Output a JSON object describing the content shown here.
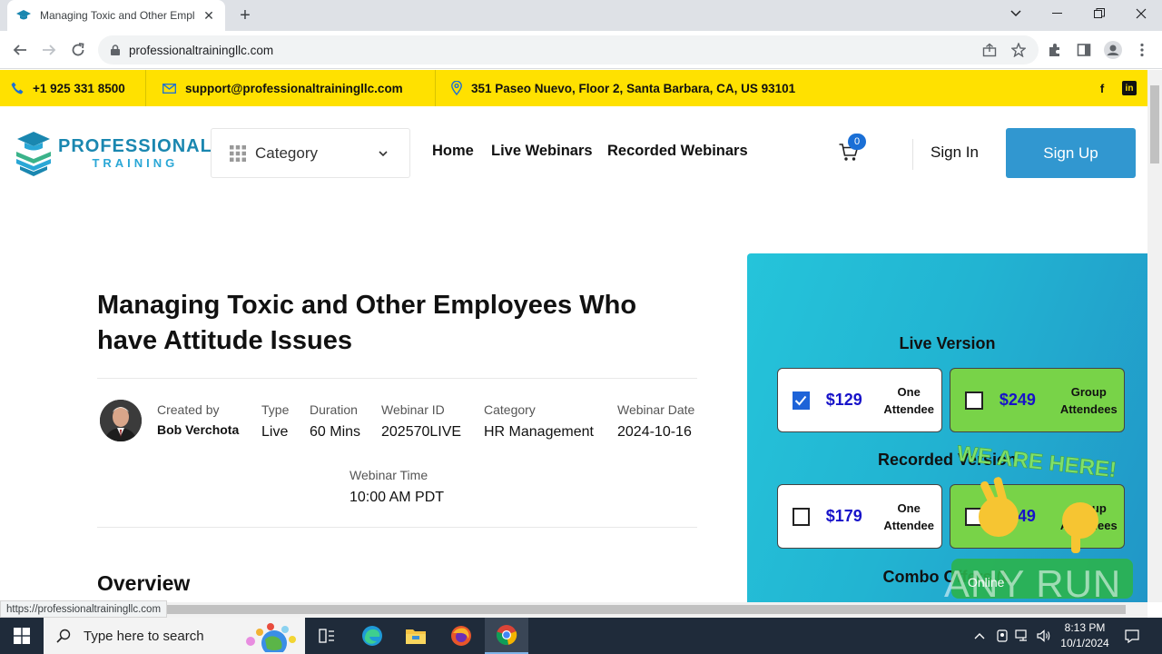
{
  "browser": {
    "tab_title": "Managing Toxic and Other Empl",
    "url": "professionaltrainingllc.com",
    "status_url": "https://professionaltrainingllc.com"
  },
  "topbar": {
    "phone": "+1 925 331 8500",
    "email": "support@professionaltrainingllc.com",
    "address": "351 Paseo Nuevo, Floor 2, Santa Barbara, CA, US 93101",
    "social_facebook": "f",
    "social_linkedin": "in"
  },
  "header": {
    "logo_line1": "PROFESSIONAL",
    "logo_line2": "TRAINING",
    "category_label": "Category",
    "nav": [
      "Home",
      "Live Webinars",
      "Recorded Webinars"
    ],
    "cart_count": "0",
    "sign_in": "Sign In",
    "sign_up": "Sign Up"
  },
  "webinar": {
    "title": "Managing Toxic and Other Employees Who have Attitude Issues",
    "created_by_label": "Created by",
    "created_by": "Bob Verchota",
    "type_label": "Type",
    "type": "Live",
    "duration_label": "Duration",
    "duration": "60 Mins",
    "id_label": "Webinar ID",
    "id": "202570LIVE",
    "category_label": "Category",
    "category": "HR Management",
    "date_label": "Webinar Date",
    "date": "2024-10-16",
    "time_label": "Webinar Time",
    "time": "10:00 AM PDT",
    "overview": "Overview"
  },
  "pricing": {
    "live_heading": "Live Version",
    "recorded_heading": "Recorded Version",
    "combo_heading": "Combo Offers (L",
    "live": [
      {
        "price": "$129",
        "who": "One Attendee",
        "checked": true
      },
      {
        "price": "$249",
        "who": "Group Attendees",
        "checked": false
      }
    ],
    "recorded": [
      {
        "price": "$179",
        "who": "One Attendee",
        "checked": false
      },
      {
        "price": "$349",
        "who": "Group Attendees",
        "checked": false
      }
    ]
  },
  "watermark": {
    "text": "WE ARE HERE!",
    "brand": "ANY RUN",
    "online": "Online"
  },
  "taskbar": {
    "search_placeholder": "Type here to search",
    "time": "8:13 PM",
    "date": "10/1/2024"
  },
  "colors": {
    "topbar": "#ffe100",
    "brand_blue": "#3197d0",
    "price_blue": "#1712c9",
    "green_option": "#78d348"
  }
}
